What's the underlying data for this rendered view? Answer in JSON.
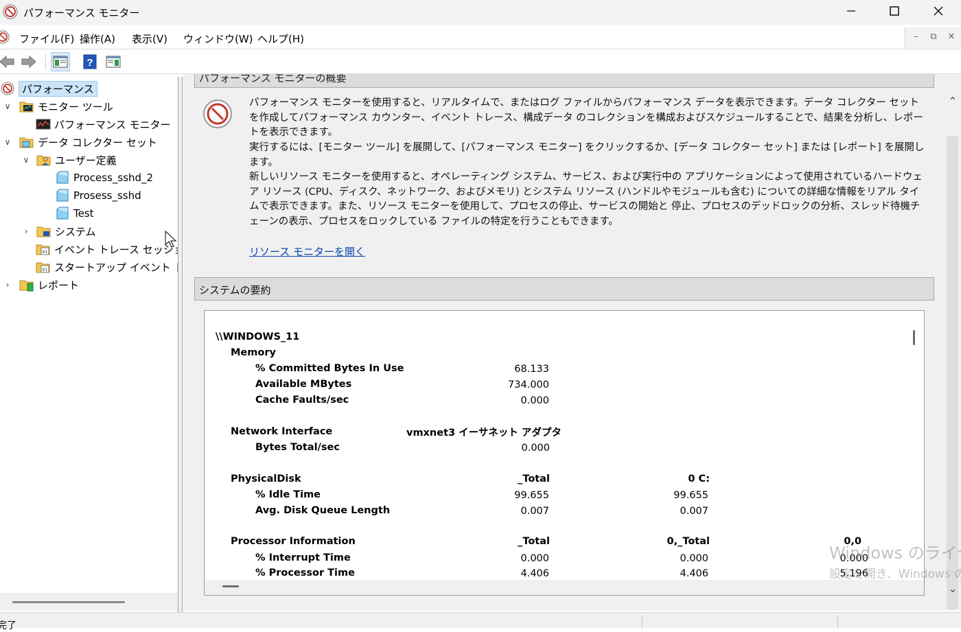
{
  "window": {
    "title": "パフォーマンス モニター"
  },
  "menu": [
    "ファイル(F)",
    "操作(A)",
    "表示(V)",
    "ウィンドウ(W)",
    "ヘルプ(H)"
  ],
  "toolbar": {
    "back": "back-arrow-icon",
    "forward": "forward-arrow-icon",
    "console_tree": "console-tree-icon",
    "help": "help-icon",
    "action_pane": "action-pane-icon"
  },
  "tree": {
    "root": "パフォーマンス",
    "monitoring_tools": "モニター ツール",
    "performance_monitor": "パフォーマンス モニター",
    "data_collector_sets": "データ コレクター セット",
    "user_defined": "ユーザー定義",
    "user_sets": [
      "Process_sshd_2",
      "Prosess_sshd",
      "Test"
    ],
    "system": "システム",
    "event_trace": "イベント トレース セッション",
    "startup_event_trace": "スタートアップ イベント トレース セッション",
    "reports": "レポート"
  },
  "overview": {
    "header": "パフォーマンス モニターの概要",
    "p1": "パフォーマンス モニターを使用すると、リアルタイムで、またはログ ファイルからパフォーマンス データを表示できます。データ コレクター セットを作成してパフォーマンス カウンター、イベント トレース、構成データ のコレクションを構成およびスケジュールすることで、結果を分析し、レポートを表示できます。",
    "p2": "実行するには、[モニター ツール] を展開して、[パフォーマンス モニター] をクリックするか、[データ コレクター セット] または [レポート] を展開します。",
    "p3": "新しいリソース モニターを使用すると、オペレーティング システム、サービス、および実行中の アプリケーションによって使用されているハードウェア リソース (CPU、ディスク、ネットワーク、およびメモリ) とシステム リソース (ハンドルやモジュールも含む) についての詳細な情報をリアル タイムで表示できます。また、リソース モニターを使用して、プロセスの停止、サービスの開始と 停止、プロセスのデッドロックの分析、スレッド待機チェーンの表示、プロセスをロックしている ファイルの特定を行うこともできます。",
    "link": "リソース モニターを開く"
  },
  "summary": {
    "header": "システムの要約",
    "machine": "\\\\WINDOWS_11",
    "memory": {
      "label": "Memory",
      "rows": [
        {
          "name": "% Committed Bytes In Use",
          "v1": "68.133"
        },
        {
          "name": "Available MBytes",
          "v1": "734.000"
        },
        {
          "name": "Cache Faults/sec",
          "v1": "0.000"
        }
      ]
    },
    "network": {
      "label": "Network Interface",
      "instance": "vmxnet3 イーサネット アダプタ",
      "rows": [
        {
          "name": "Bytes Total/sec",
          "v1": "0.000"
        }
      ]
    },
    "disk": {
      "label": "PhysicalDisk",
      "instances": [
        "_Total",
        "0 C:"
      ],
      "rows": [
        {
          "name": "% Idle Time",
          "v1": "99.655",
          "v2": "99.655"
        },
        {
          "name": "Avg. Disk Queue Length",
          "v1": "0.007",
          "v2": "0.007"
        }
      ]
    },
    "processor": {
      "label": "Processor Information",
      "instances": [
        "_Total",
        "0,_Total",
        "0,0"
      ],
      "rows": [
        {
          "name": "% Interrupt Time",
          "v1": "0.000",
          "v2": "0.000",
          "v3": "0.000"
        },
        {
          "name": "% Processor Time",
          "v1": "4.406",
          "v2": "4.406",
          "v3": "5.196"
        }
      ]
    }
  },
  "status": {
    "text": "完了"
  },
  "watermark": {
    "line1": "Windows のライセンス認証",
    "line2": "設定を開き、Windows のライセンス認証を行ってください。"
  }
}
